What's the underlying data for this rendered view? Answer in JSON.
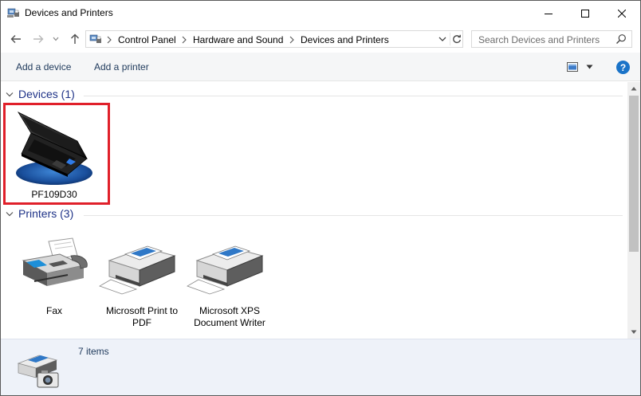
{
  "window": {
    "title": "Devices and Printers",
    "controls": {
      "minimize": "minimize",
      "maximize": "maximize",
      "close": "close"
    }
  },
  "navigation": {
    "breadcrumbs": [
      "Control Panel",
      "Hardware and Sound",
      "Devices and Printers"
    ],
    "search_placeholder": "Search Devices and Printers"
  },
  "commands": {
    "add_device": "Add a device",
    "add_printer": "Add a printer",
    "help_label": "?"
  },
  "groups": {
    "devices": {
      "title": "Devices (1)",
      "items": [
        {
          "label": "PF109D30",
          "icon": "laptop-icon",
          "selected": true
        }
      ]
    },
    "printers": {
      "title": "Printers (3)",
      "items": [
        {
          "label": "Fax",
          "icon": "fax-icon"
        },
        {
          "label": "Microsoft Print to PDF",
          "icon": "printer-icon"
        },
        {
          "label": "Microsoft XPS Document Writer",
          "icon": "printer-icon"
        }
      ]
    }
  },
  "details": {
    "count": "7 items",
    "icon": "printer-camera-icon"
  },
  "colors": {
    "selection_border": "#e0202a",
    "group_title": "#1e3287",
    "help_blue": "#1a73c8",
    "details_bg": "#eef2f9"
  }
}
